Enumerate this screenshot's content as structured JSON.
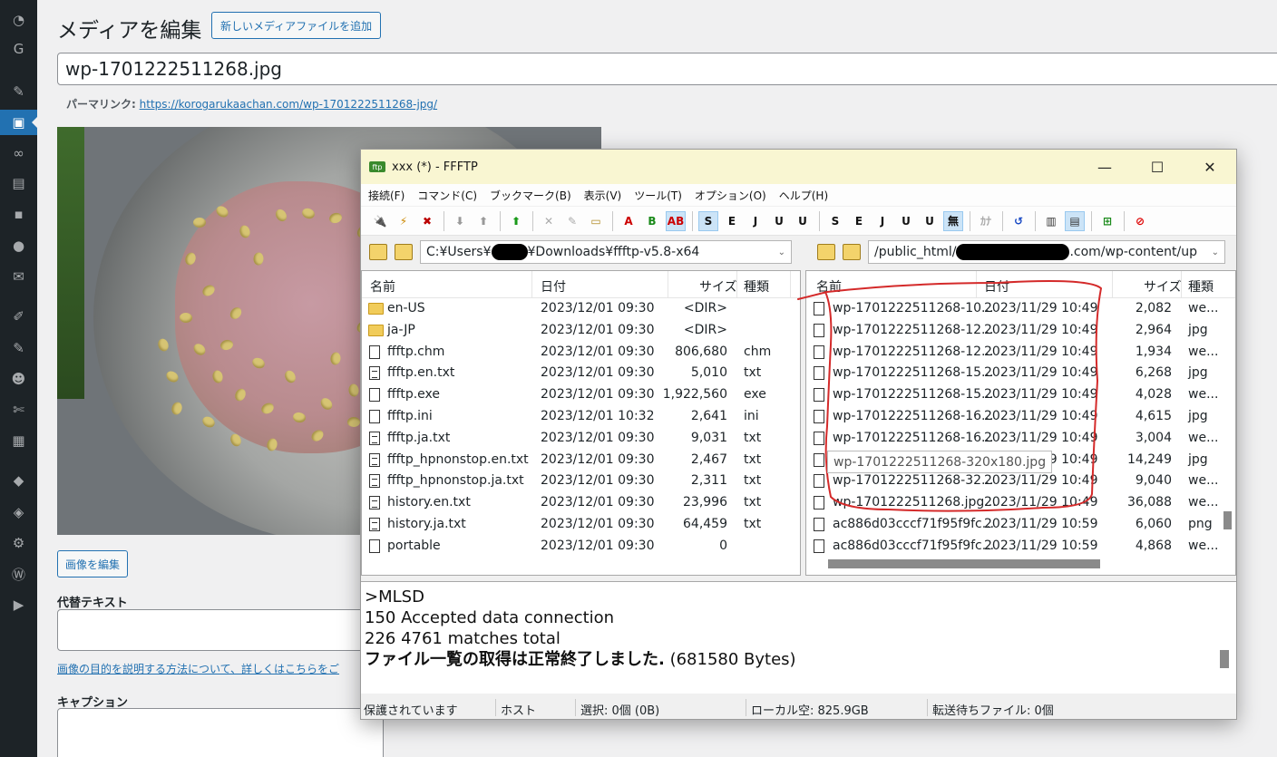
{
  "wp": {
    "sidebar_icons": [
      "dashboard-icon",
      "g-icon",
      "pin-icon",
      "media-icon",
      "links-icon",
      "pages-icon",
      "comments-icon",
      "circle-icon",
      "mail-icon",
      "appearance-icon",
      "plugins-icon",
      "users-icon",
      "tools-icon",
      "settings-grid-icon",
      "shield-icon",
      "cube-icon",
      "gear-icon",
      "wordpress-icon",
      "play-icon"
    ],
    "title": "メディアを編集",
    "add_new_label": "新しいメディアファイルを追加",
    "filename_value": "wp-1701222511268.jpg",
    "permalink_label": "パーマリンク:",
    "permalink_url": "https://korogarukaachan.com/wp-1701222511268-jpg/",
    "edit_image_label": "画像を編集",
    "alt_text_label": "代替テキスト",
    "alt_help_link": "画像の目的を説明する方法について、詳しくはこちらをご",
    "caption_label": "キャプション"
  },
  "ffftp": {
    "window_title": "xxx (*) - FFFTP",
    "window_controls": {
      "minimize": "—",
      "maximize": "☐",
      "close": "✕"
    },
    "menu": [
      "接続(F)",
      "コマンド(C)",
      "ブックマーク(B)",
      "表示(V)",
      "ツール(T)",
      "オプション(O)",
      "ヘルプ(H)"
    ],
    "toolbar": [
      {
        "name": "connect-icon",
        "glyph": "🔌",
        "color": "#d22"
      },
      {
        "name": "quick-connect-icon",
        "glyph": "⚡",
        "color": "#c80"
      },
      {
        "name": "disconnect-icon",
        "glyph": "✖",
        "color": "#b00"
      },
      {
        "sep": true
      },
      {
        "name": "download-icon",
        "glyph": "⬇",
        "color": "#999"
      },
      {
        "name": "upload-icon",
        "glyph": "⬆",
        "color": "#999"
      },
      {
        "sep": true
      },
      {
        "name": "mirror-upload-icon",
        "glyph": "⬆",
        "color": "#1a9a1a"
      },
      {
        "sep": true
      },
      {
        "name": "delete-icon",
        "glyph": "✕",
        "color": "#aaa"
      },
      {
        "name": "rename-icon",
        "glyph": "✎",
        "color": "#aaa"
      },
      {
        "name": "mkdir-icon",
        "glyph": "▭",
        "color": "#b08a24"
      },
      {
        "sep": true
      },
      {
        "name": "ascii-mode-icon",
        "glyph": "A",
        "color": "#c00"
      },
      {
        "name": "binary-mode-icon",
        "glyph": "B",
        "color": "#1a8a1a"
      },
      {
        "name": "auto-mode-icon",
        "glyph": "AB",
        "color": "#c00",
        "sel": true
      },
      {
        "sep": true
      },
      {
        "name": "sjis-host-icon",
        "glyph": "S",
        "color": "#111",
        "sel": true
      },
      {
        "name": "euc-host-icon",
        "glyph": "E",
        "color": "#111"
      },
      {
        "name": "jis-host-icon",
        "glyph": "J",
        "color": "#111"
      },
      {
        "name": "utf8-host-icon",
        "glyph": "U",
        "color": "#111"
      },
      {
        "name": "utf8bom-host-icon",
        "glyph": "U",
        "color": "#111"
      },
      {
        "sep": true
      },
      {
        "name": "sjis-local-icon",
        "glyph": "S",
        "color": "#111"
      },
      {
        "name": "euc-local-icon",
        "glyph": "E",
        "color": "#111"
      },
      {
        "name": "jis-local-icon",
        "glyph": "J",
        "color": "#111"
      },
      {
        "name": "utf8-local-icon",
        "glyph": "U",
        "color": "#111"
      },
      {
        "name": "utf8bom-local-icon",
        "glyph": "U",
        "color": "#111"
      },
      {
        "name": "no-convert-icon",
        "glyph": "無",
        "color": "#111",
        "sel": true
      },
      {
        "sep": true
      },
      {
        "name": "kana-convert-icon",
        "glyph": "ｶﾅ",
        "color": "#aaa"
      },
      {
        "sep": true
      },
      {
        "name": "refresh-icon",
        "glyph": "↺",
        "color": "#1a4ac4"
      },
      {
        "sep": true
      },
      {
        "name": "list-view-icon",
        "glyph": "▥",
        "color": "#333"
      },
      {
        "name": "detail-view-icon",
        "glyph": "▤",
        "color": "#333",
        "sel": true
      },
      {
        "sep": true
      },
      {
        "name": "sync-folder-icon",
        "glyph": "⊞",
        "color": "#1a8a1a"
      },
      {
        "sep": true
      },
      {
        "name": "stop-icon",
        "glyph": "⊘",
        "color": "#d00"
      }
    ],
    "local_path": "C:¥Users¥",
    "local_path_tail": "¥Downloads¥ffftp-v5.8-x64",
    "remote_path": "/public_html/",
    "remote_path_tail": ".com/wp-content/up",
    "local_headers": {
      "name": "名前",
      "date": "日付",
      "size": "サイズ",
      "type": "種類"
    },
    "remote_headers": {
      "name": "名前",
      "date": "日付",
      "size": "サイズ",
      "type": "種類"
    },
    "local_files": [
      {
        "kind": "dir",
        "name": "en-US",
        "date": "2023/12/01 09:30",
        "size": "<DIR>",
        "type": ""
      },
      {
        "kind": "dir",
        "name": "ja-JP",
        "date": "2023/12/01 09:30",
        "size": "<DIR>",
        "type": ""
      },
      {
        "kind": "file",
        "name": "ffftp.chm",
        "date": "2023/12/01 09:30",
        "size": "806,680",
        "type": "chm"
      },
      {
        "kind": "txt",
        "name": "ffftp.en.txt",
        "date": "2023/12/01 09:30",
        "size": "5,010",
        "type": "txt"
      },
      {
        "kind": "file",
        "name": "ffftp.exe",
        "date": "2023/12/01 09:30",
        "size": "1,922,560",
        "type": "exe"
      },
      {
        "kind": "file",
        "name": "ffftp.ini",
        "date": "2023/12/01 10:32",
        "size": "2,641",
        "type": "ini"
      },
      {
        "kind": "txt",
        "name": "ffftp.ja.txt",
        "date": "2023/12/01 09:30",
        "size": "9,031",
        "type": "txt"
      },
      {
        "kind": "txt",
        "name": "ffftp_hpnonstop.en.txt",
        "date": "2023/12/01 09:30",
        "size": "2,467",
        "type": "txt"
      },
      {
        "kind": "txt",
        "name": "ffftp_hpnonstop.ja.txt",
        "date": "2023/12/01 09:30",
        "size": "2,311",
        "type": "txt"
      },
      {
        "kind": "txt",
        "name": "history.en.txt",
        "date": "2023/12/01 09:30",
        "size": "23,996",
        "type": "txt"
      },
      {
        "kind": "txt",
        "name": "history.ja.txt",
        "date": "2023/12/01 09:30",
        "size": "64,459",
        "type": "txt"
      },
      {
        "kind": "file",
        "name": "portable",
        "date": "2023/12/01 09:30",
        "size": "0",
        "type": ""
      }
    ],
    "remote_files": [
      {
        "name": "wp-1701222511268-10...",
        "date": "2023/11/29 10:49",
        "size": "2,082",
        "type": "we..."
      },
      {
        "name": "wp-1701222511268-12...",
        "date": "2023/11/29 10:49",
        "size": "2,964",
        "type": "jpg"
      },
      {
        "name": "wp-1701222511268-12...",
        "date": "2023/11/29 10:49",
        "size": "1,934",
        "type": "we..."
      },
      {
        "name": "wp-1701222511268-15...",
        "date": "2023/11/29 10:49",
        "size": "6,268",
        "type": "jpg"
      },
      {
        "name": "wp-1701222511268-15...",
        "date": "2023/11/29 10:49",
        "size": "4,028",
        "type": "we..."
      },
      {
        "name": "wp-1701222511268-16...",
        "date": "2023/11/29 10:49",
        "size": "4,615",
        "type": "jpg"
      },
      {
        "name": "wp-1701222511268-16...",
        "date": "2023/11/29 10:49",
        "size": "3,004",
        "type": "we..."
      },
      {
        "name": "",
        "date": "2023/11/29 10:49",
        "size": "14,249",
        "type": "jpg"
      },
      {
        "name": "wp-1701222511268-32...",
        "date": "2023/11/29 10:49",
        "size": "9,040",
        "type": "we..."
      },
      {
        "name": "wp-1701222511268.jpg...",
        "date": "2023/11/29 10:49",
        "size": "36,088",
        "type": "we..."
      },
      {
        "name": "ac886d03cccf71f95f9fc...",
        "date": "2023/11/29 10:59",
        "size": "6,060",
        "type": "png"
      },
      {
        "name": "ac886d03cccf71f95f9fc...",
        "date": "2023/11/29 10:59",
        "size": "4,868",
        "type": "we..."
      }
    ],
    "tooltip": "wp-1701222511268-320x180.jpg",
    "log_lines": [
      ">MLSD",
      "150 Accepted data connection",
      "226 4761 matches total"
    ],
    "log_result": "ファイル一覧の取得は正常終了しました.",
    "log_bytes": "(681580 Bytes)",
    "status": {
      "security": "保護されています",
      "host": "ホスト",
      "selection": "選択: 0個 (0B)",
      "local_free": "ローカル空: 825.9GB",
      "queue": "転送待ちファイル: 0個"
    },
    "annotation_color": "#d42a2a"
  }
}
